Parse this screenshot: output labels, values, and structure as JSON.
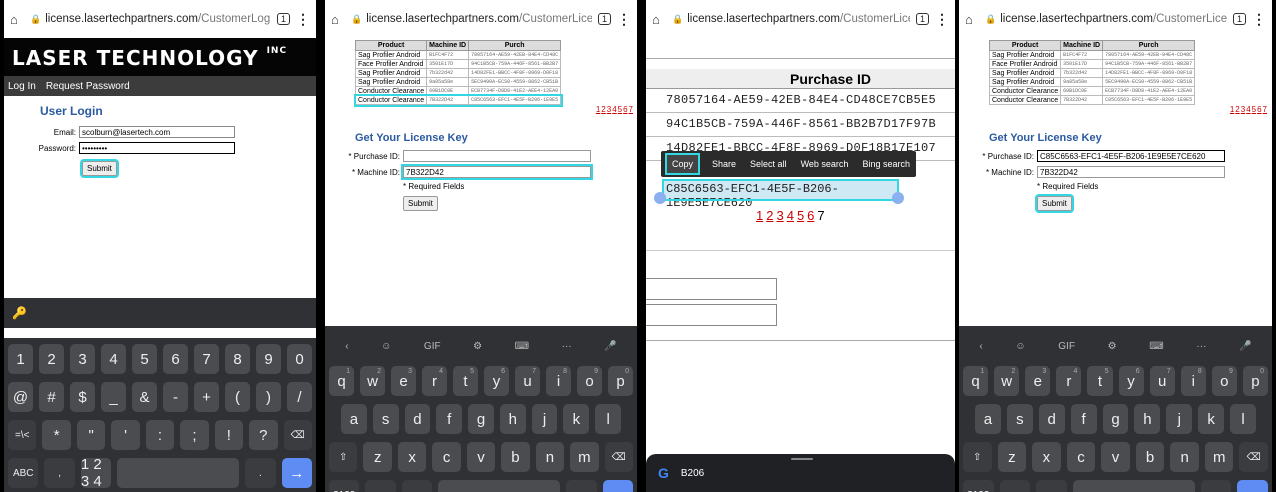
{
  "panel1": {
    "url_main": "license.lasertechpartners.com",
    "url_path": "/CustomerLogin.a",
    "tab_count": "1",
    "logo": "LASER TECHNOLOGY",
    "logo_suffix": "INC",
    "nav": [
      "Log In",
      "Request Password"
    ],
    "title": "User Login",
    "email_label": "Email:",
    "email_value": "scolburn@lasertech.com",
    "password_label": "Password:",
    "password_value": "•••••••••",
    "submit": "Submit",
    "key_icon": "key-icon",
    "keyboard": {
      "row1": [
        "1",
        "2",
        "3",
        "4",
        "5",
        "6",
        "7",
        "8",
        "9",
        "0"
      ],
      "row2": [
        "@",
        "#",
        "$",
        "_",
        "&",
        "-",
        "+",
        "(",
        ")",
        "/"
      ],
      "row3": [
        "=\\<",
        "*",
        "\"",
        "'",
        ":",
        ";",
        "!",
        "?",
        "⌫"
      ],
      "row4": [
        "ABC",
        ",",
        "1 2 3 4",
        "",
        ".",
        "→"
      ]
    }
  },
  "table": {
    "headers": [
      "Product",
      "Machine ID",
      "Purch"
    ],
    "rows": [
      [
        "Sag Profiler Android",
        "B1FC4F72",
        "78057164-AE59-42EB-84E4-CD48C"
      ],
      [
        "Face Profiler Android",
        "3501E17D",
        "94C1B5CB-759A-446F-8561-BB2B7"
      ],
      [
        "Sag Profiler Android",
        "7b322d42",
        "14D82FE1-BBCC-4F8F-8969-D0F18"
      ],
      [
        "Sag Profiler Android",
        "9a85a58e",
        "5EC9490A-ECS0-4559-8862-CB51B"
      ],
      [
        "Conductor Clearance",
        "60B1DC0E",
        "ECB7734F-D8D8-41E2-AEE4-12EA0"
      ],
      [
        "Conductor Clearance",
        "7B322D42",
        "C85C6563-EFC1-4E5F-B206-1E9E5"
      ]
    ],
    "pager": [
      "1",
      "2",
      "3",
      "4",
      "5",
      "6",
      "7"
    ]
  },
  "panel2": {
    "url_main": "license.lasertechpartners.com",
    "url_path": "/CustomerLicense",
    "heading": "Get Your License Key",
    "purchase_label": "* Purchase ID:",
    "purchase_value": "",
    "machine_label": "* Machine ID:",
    "machine_value": "7B322D42",
    "required": "* Required Fields",
    "submit": "Submit",
    "kb_row1": [
      "q",
      "w",
      "e",
      "r",
      "t",
      "y",
      "u",
      "i",
      "o",
      "p"
    ],
    "kb_sup1": [
      "1",
      "2",
      "3",
      "4",
      "5",
      "6",
      "7",
      "8",
      "9",
      "0"
    ],
    "kb_row2": [
      "a",
      "s",
      "d",
      "f",
      "g",
      "h",
      "j",
      "k",
      "l"
    ],
    "kb_row3": [
      "⇧",
      "z",
      "x",
      "c",
      "v",
      "b",
      "n",
      "m",
      "⌫"
    ],
    "kb_row4": [
      "?123",
      ",",
      "☺",
      "",
      ".",
      "→"
    ],
    "suggest": [
      "‹",
      "☺",
      "GIF",
      "⚙",
      "⌨",
      "···",
      "🎤"
    ]
  },
  "panel3": {
    "url_main": "license.lasertechpartners.com",
    "url_path": "/CustomerLicense",
    "header": "Purchase ID",
    "ids": [
      "78057164-AE59-42EB-84E4-CD48CE7CB5E5",
      "94C1B5CB-759A-446F-8561-BB2B7D17F97B",
      "14D82FE1-BBCC-4F8F-8969-D0F18B17E107"
    ],
    "selected_id": "C85C6563-EFC1-4E5F-B206-1E9E5E7CE620",
    "menu": [
      "Copy",
      "Share",
      "Select all",
      "Web search",
      "Bing search"
    ],
    "pager_links": [
      "1",
      "2",
      "3",
      "4",
      "5",
      "6"
    ],
    "pager_current": "7",
    "google_text": "B206"
  },
  "panel4": {
    "url_main": "license.lasertechpartners.com",
    "url_path": "/CustomerLicense",
    "heading": "Get Your License Key",
    "purchase_label": "* Purchase ID:",
    "purchase_value": "C85C6563-EFC1-4E5F-B206-1E9E5E7CE620",
    "machine_label": "* Machine ID:",
    "machine_value": "7B322D42",
    "required": "* Required Fields",
    "submit": "Submit",
    "kb_row4": [
      "?123",
      ",",
      "☺",
      "",
      ".",
      "⇥"
    ]
  },
  "colors": {
    "highlight": "#33d6e3",
    "link_red": "#cc0000",
    "title_blue": "#2b5aa0",
    "keyboard_bg": "#2f3134"
  }
}
